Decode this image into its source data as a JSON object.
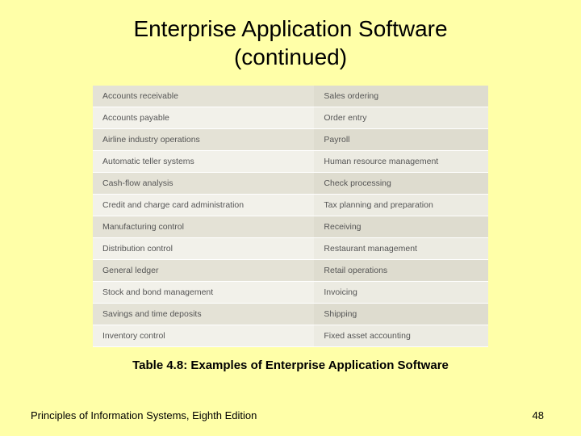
{
  "title_line1": "Enterprise Application Software",
  "title_line2": "(continued)",
  "caption": "Table 4.8: Examples of Enterprise Application Software",
  "footer_left": "Principles of Information Systems, Eighth Edition",
  "footer_right": "48",
  "rows": [
    {
      "left": "Accounts receivable",
      "right": "Sales ordering"
    },
    {
      "left": "Accounts payable",
      "right": "Order entry"
    },
    {
      "left": "Airline industry operations",
      "right": "Payroll"
    },
    {
      "left": "Automatic teller systems",
      "right": "Human resource management"
    },
    {
      "left": "Cash-flow analysis",
      "right": "Check processing"
    },
    {
      "left": "Credit and charge card administration",
      "right": "Tax planning and preparation"
    },
    {
      "left": "Manufacturing control",
      "right": "Receiving"
    },
    {
      "left": "Distribution control",
      "right": "Restaurant management"
    },
    {
      "left": "General ledger",
      "right": "Retail operations"
    },
    {
      "left": "Stock and bond management",
      "right": "Invoicing"
    },
    {
      "left": "Savings and time deposits",
      "right": "Shipping"
    },
    {
      "left": "Inventory control",
      "right": "Fixed asset accounting"
    }
  ]
}
